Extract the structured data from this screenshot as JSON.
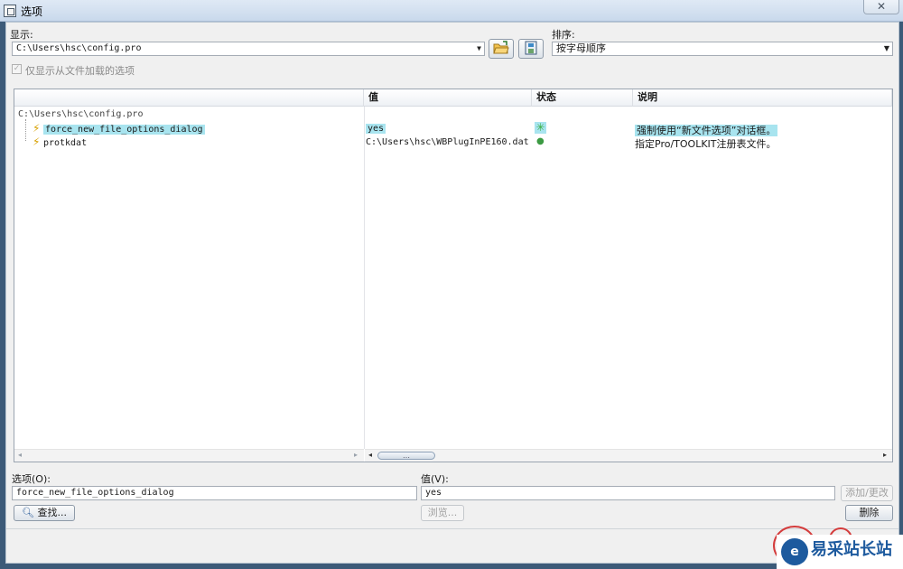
{
  "window": {
    "title": "选项",
    "close": "✕"
  },
  "display": {
    "label": "显示:",
    "value": "C:\\Users\\hsc\\config.pro"
  },
  "sort": {
    "label": "排序:",
    "value": "按字母顺序"
  },
  "filter_checkbox": {
    "label": "仅显示从文件加载的选项",
    "checked": true
  },
  "table": {
    "columns": [
      "",
      "值",
      "状态",
      "说明"
    ],
    "root": "C:\\Users\\hsc\\config.pro",
    "rows": [
      {
        "name": "force_new_file_options_dialog",
        "value": "yes",
        "status": "changed",
        "status_icon": "✳",
        "description": "强制使用“新文件选项”对话框。",
        "selected": true
      },
      {
        "name": "protkdat",
        "value": "C:\\Users\\hsc\\WBPlugInPE160.dat",
        "status": "default",
        "status_icon": "●",
        "description": "指定Pro/TOOLKIT注册表文件。",
        "selected": false
      }
    ],
    "scroll_thumb": "…"
  },
  "option_field": {
    "label": "选项(O):",
    "value": "force_new_file_options_dialog"
  },
  "value_field": {
    "label": "值(V):",
    "value": "yes"
  },
  "buttons": {
    "find": "查找...",
    "browse": "浏览...",
    "add_change": "添加/更改",
    "delete": "删除"
  },
  "watermark": {
    "text": "易采站长站",
    "logo": "e"
  },
  "colors": {
    "selection": "#a8e4ef",
    "status_green": "#3cb043",
    "bolt": "#d7a000"
  }
}
